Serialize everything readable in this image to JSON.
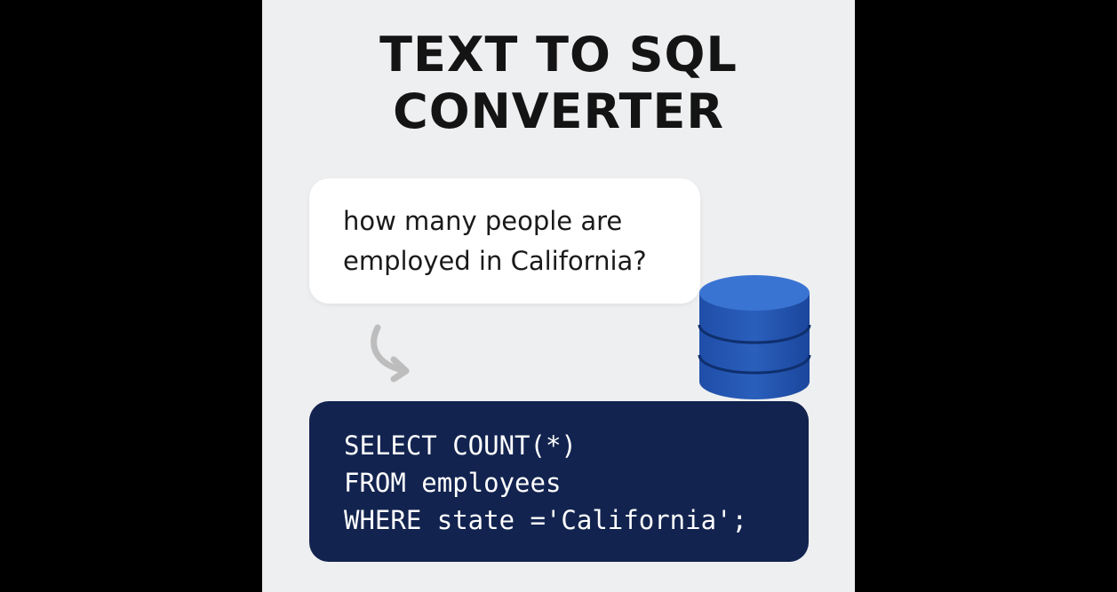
{
  "title": {
    "line1": "TEXT TO SQL",
    "line2": "CONVERTER"
  },
  "question": {
    "line1": "how many people are",
    "line2": "employed in California?"
  },
  "sql": {
    "line1": "SELECT COUNT(*)",
    "line2": "FROM employees",
    "line3": "WHERE state ='California';"
  },
  "icons": {
    "arrow": "curved-arrow-icon",
    "database": "database-icon"
  },
  "colors": {
    "background": "#eeeff1",
    "code_background": "#12234f",
    "database": "#2f65bf",
    "arrow": "#bdbdbd"
  }
}
